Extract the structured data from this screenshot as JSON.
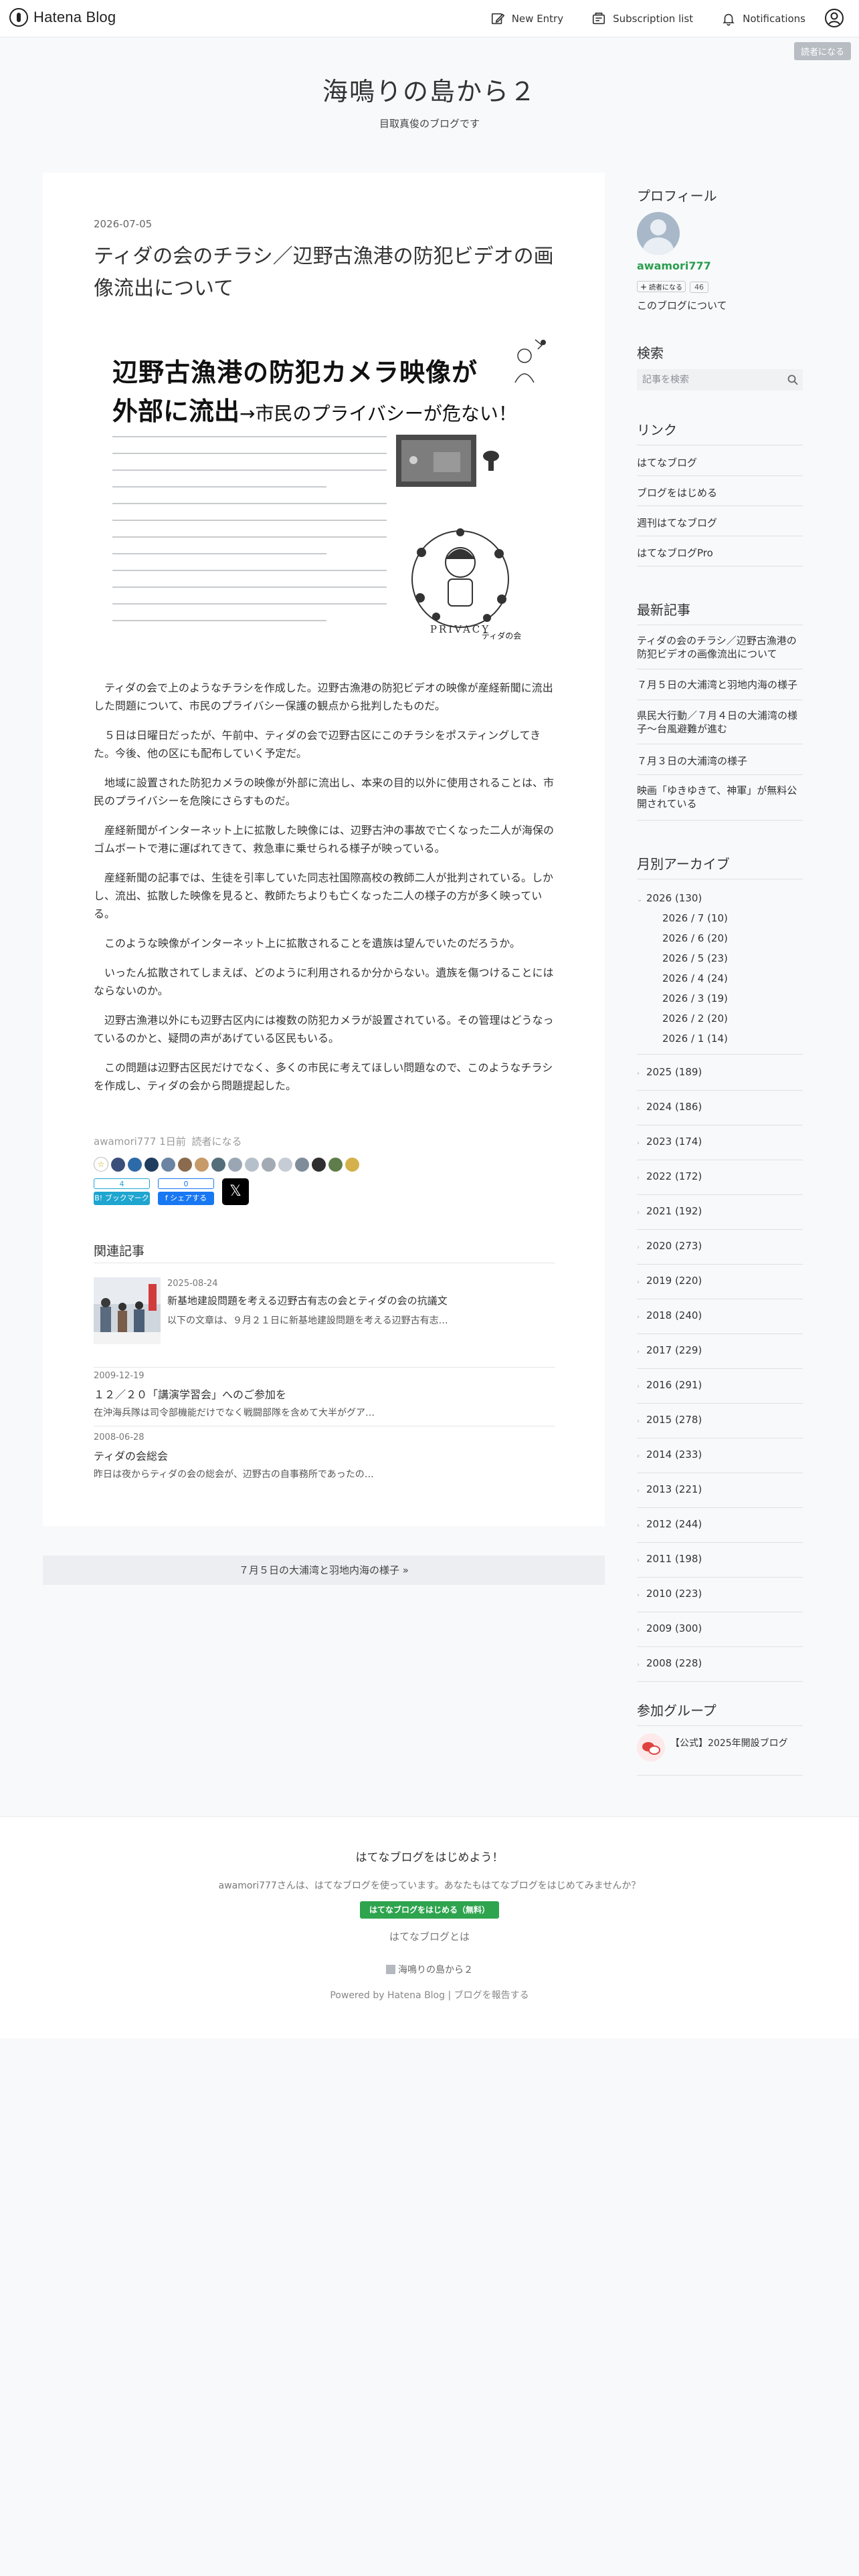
{
  "topbar": {
    "brand": "Hatena Blog",
    "nav": [
      {
        "label": "New Entry"
      },
      {
        "label": "Subscription list"
      },
      {
        "label": "Notifications"
      }
    ],
    "reader_badge": "読者になる"
  },
  "blog": {
    "title": "海鳴りの島から２",
    "description": "目取真俊のブログです"
  },
  "entry": {
    "date": "2026-07-05",
    "title": "ティダの会のチラシ／辺野古漁港の防犯ビデオの画像流出について",
    "figure": {
      "headline1": "辺野古漁港の防犯カメラ映像が",
      "headline2_a": "外部に流出",
      "headline2_arrow": "→",
      "headline2_b": "市民のプライバシーが危ない！",
      "privacy_label": "PRIVACY",
      "credit": "ティダの会"
    },
    "paragraphs": [
      "ティダの会で上のようなチラシを作成した。辺野古漁港の防犯ビデオの映像が産経新聞に流出した問題について、市民のプライバシー保護の観点から批判したものだ。",
      "５日は日曜日だったが、午前中、ティダの会で辺野古区にこのチラシをポスティングしてきた。今後、他の区にも配布していく予定だ。",
      "地域に設置された防犯カメラの映像が外部に流出し、本来の目的以外に使用されることは、市民のプライバシーを危険にさらすものだ。",
      "産経新聞がインターネット上に拡散した映像には、辺野古沖の事故で亡くなった二人が海保のゴムボートで港に運ばれてきて、救急車に乗せられる様子が映っている。",
      "産経新聞の記事では、生徒を引率していた同志社国際高校の教師二人が批判されている。しかし、流出、拡散した映像を見ると、教師たちよりも亡くなった二人の様子の方が多く映っている。",
      "このような映像がインターネット上に拡散されることを遺族は望んでいたのだろうか。",
      "いったん拡散されてしまえば、どのように利用されるか分からない。遺族を傷つけることにはならないのか。",
      "辺野古漁港以外にも辺野古区内には複数の防犯カメラが設置されている。その管理はどうなっているのかと、疑問の声があげている区民もいる。",
      "この問題は辺野古区民だけでなく、多くの市民に考えてほしい問題なので、このようなチラシを作成し、ティダの会から問題提起した。"
    ],
    "meta": {
      "author": "awamori777",
      "time": "1日前",
      "subscribe": "読者になる"
    },
    "share": {
      "hatena_count": "4",
      "hatena_label": "B! ブックマーク",
      "fb_count": "0",
      "fb_label": "f シェアする",
      "x_label": "𝕏"
    }
  },
  "related": {
    "heading": "関連記事",
    "items": [
      {
        "date": "2025-08-24",
        "title": "新基地建設問題を考える辺野古有志の会とティダの会の抗議文",
        "snippet": "以下の文章は、９月２１日に新基地建設問題を考える辺野古有志…"
      },
      {
        "date": "2009-12-19",
        "title": "１２／２０「講演学習会」へのご参加を",
        "snippet": "在沖海兵隊は司令部機能だけでなく戦闘部隊を含めて大半がグア…"
      },
      {
        "date": "2008-06-28",
        "title": "ティダの会総会",
        "snippet": "昨日は夜からティダの会の総会が、辺野古の自事務所であったの…"
      }
    ]
  },
  "next_link": "７月５日の大浦湾と羽地内海の様子 »",
  "sidebar": {
    "profile": {
      "heading": "プロフィール",
      "name": "awamori777",
      "reader_btn": "読者になる",
      "reader_count": "46",
      "about": "このブログについて"
    },
    "search": {
      "heading": "検索",
      "placeholder": "記事を検索"
    },
    "links": {
      "heading": "リンク",
      "items": [
        "はてなブログ",
        "ブログをはじめる",
        "週刊はてなブログ",
        "はてなブログPro"
      ]
    },
    "recent": {
      "heading": "最新記事",
      "items": [
        "ティダの会のチラシ／辺野古漁港の防犯ビデオの画像流出について",
        "７月５日の大浦湾と羽地内海の様子",
        "県民大行動／７月４日の大浦湾の様子〜台風避難が進む",
        "７月３日の大浦湾の様子",
        "映画「ゆきゆきて、神軍」が無料公開されている"
      ]
    },
    "archive": {
      "heading": "月別アーカイブ",
      "current_year": "2026 (130)",
      "months": [
        "2026 / 7 (10)",
        "2026 / 6 (20)",
        "2026 / 5 (23)",
        "2026 / 4 (24)",
        "2026 / 3 (19)",
        "2026 / 2 (20)",
        "2026 / 1 (14)"
      ],
      "years": [
        "2025 (189)",
        "2024 (186)",
        "2023 (174)",
        "2022 (172)",
        "2021 (192)",
        "2020 (273)",
        "2019 (220)",
        "2018 (240)",
        "2017 (229)",
        "2016 (291)",
        "2015 (278)",
        "2014 (233)",
        "2013 (221)",
        "2012 (244)",
        "2011 (198)",
        "2010 (223)",
        "2009 (300)",
        "2008 (228)"
      ]
    },
    "groups": {
      "heading": "参加グループ",
      "item": "【公式】2025年開設ブログ"
    }
  },
  "footer": {
    "headline": "はてなブログをはじめよう！",
    "message": "awamori777さんは、はてなブログを使っています。あなたもはてなブログをはじめてみませんか？",
    "cta": "はてなブログをはじめる（無料）",
    "about": "はてなブログとは",
    "blog_name": "海鳴りの島から２",
    "powered": "Powered by Hatena Blog",
    "separator": "|",
    "report": "ブログを報告する"
  },
  "colors": {
    "accent_green": "#2ea44f",
    "hatena_blue": "#1ea5d0",
    "facebook_blue": "#1877f2",
    "page_bg": "#f8f9fb"
  }
}
